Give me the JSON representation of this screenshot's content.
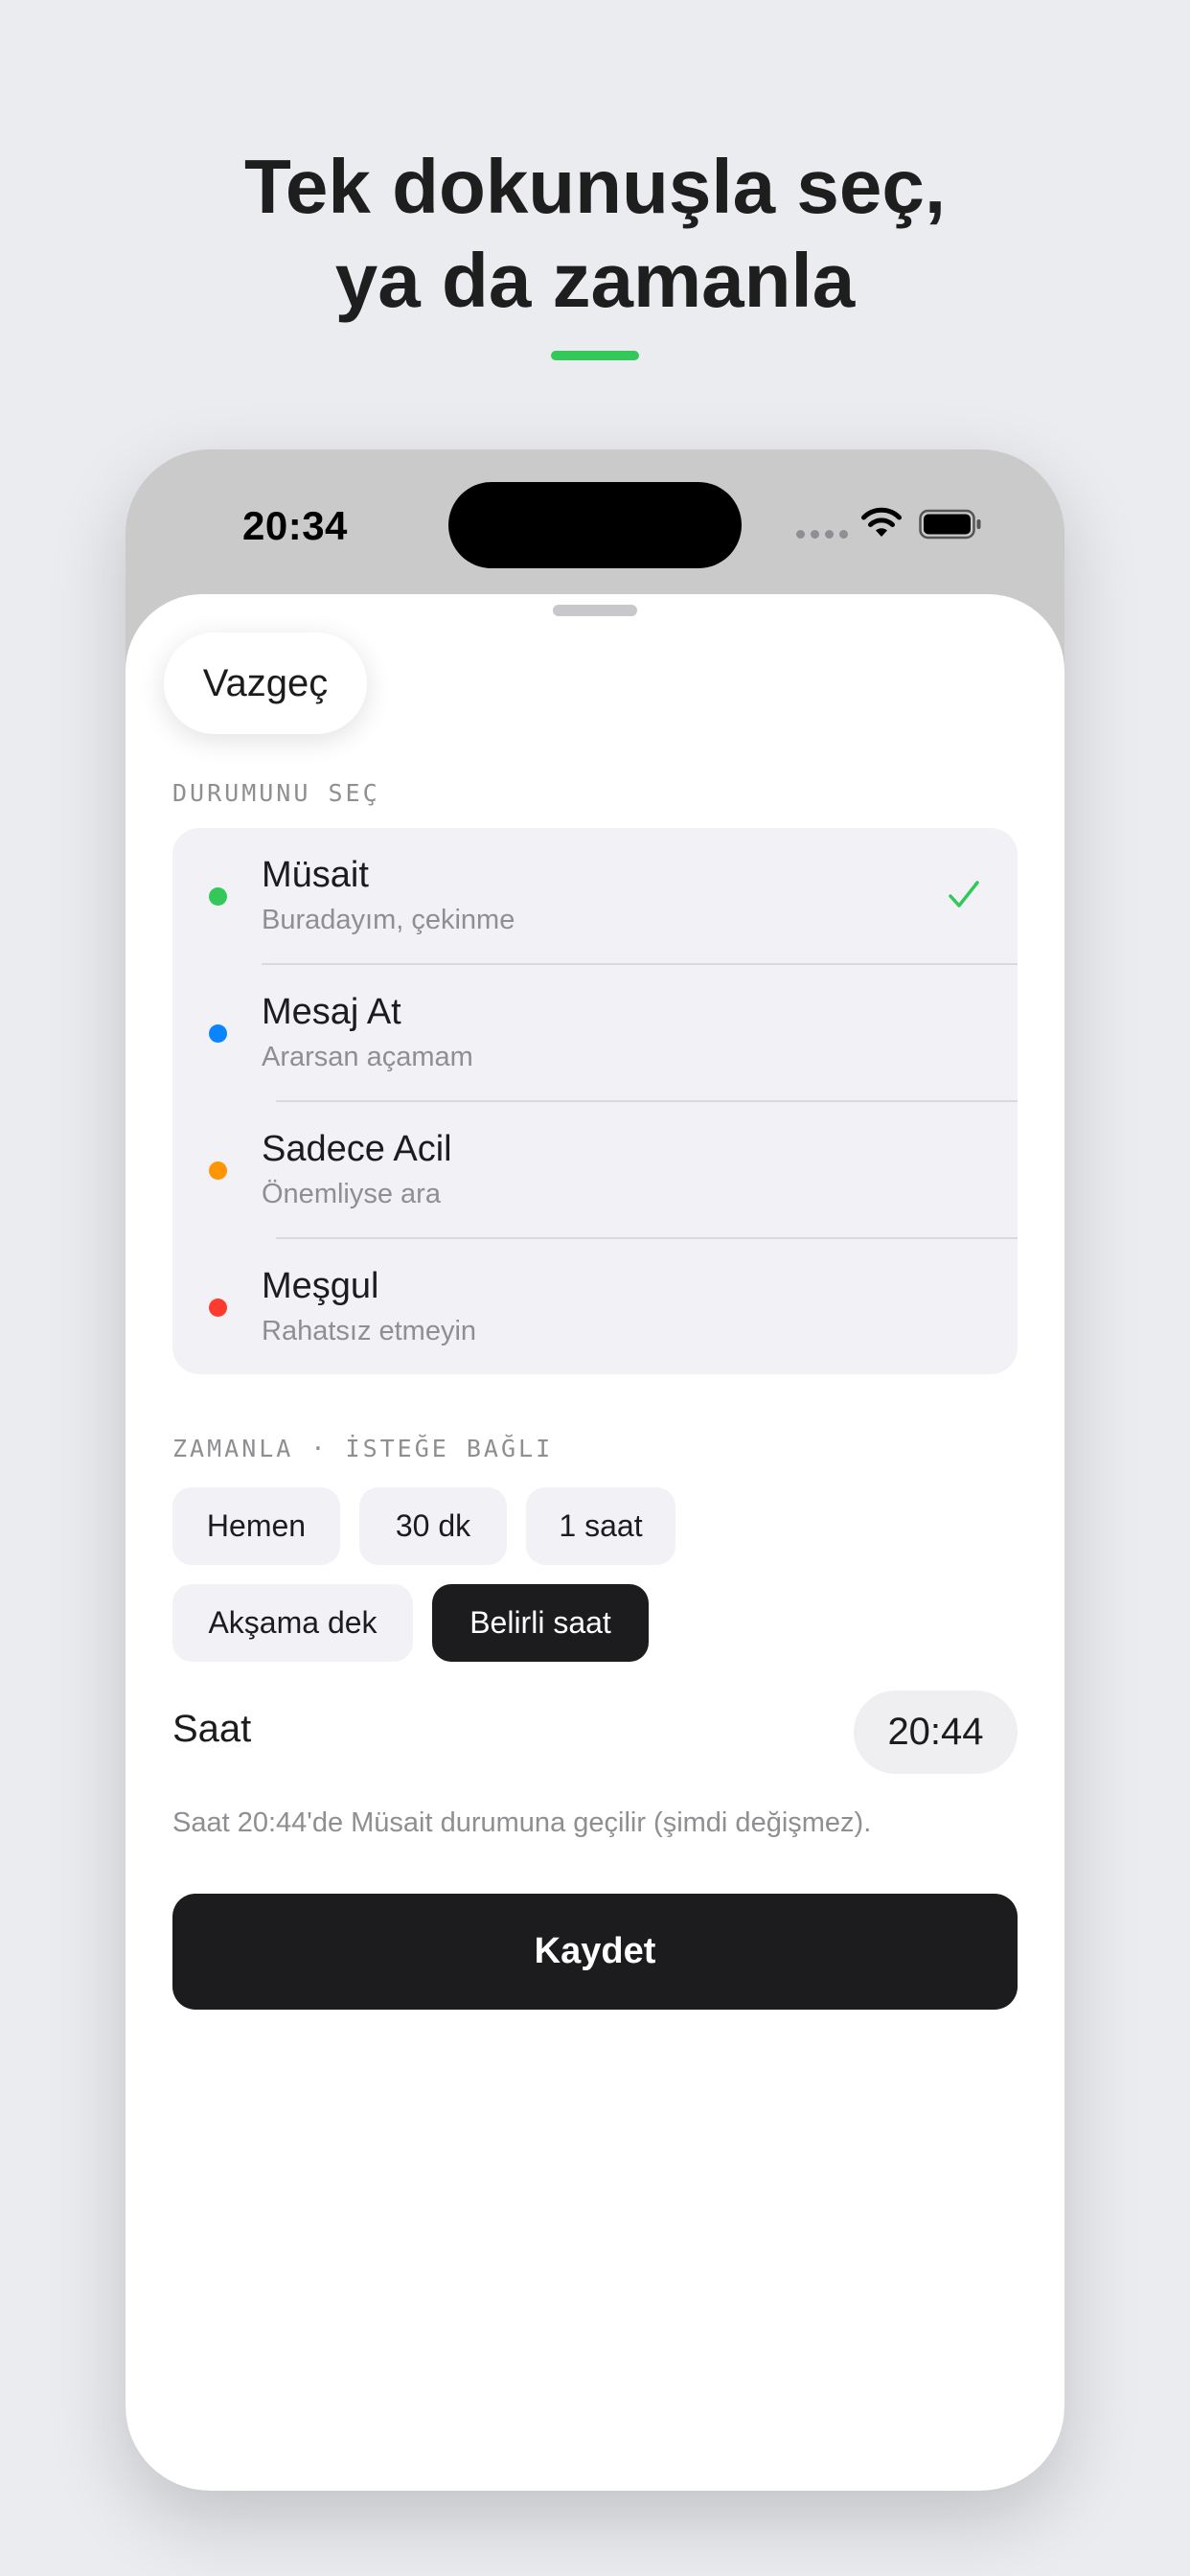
{
  "headline": {
    "line1": "Tek dokunuşla seç,",
    "line2": "ya da zamanla",
    "accent_color": "#34c759"
  },
  "status_bar": {
    "time": "20:34",
    "icons": [
      "cellular-signal-icon",
      "wifi-icon",
      "battery-icon"
    ]
  },
  "sheet": {
    "cancel_label": "Vazgeç",
    "status_section_label": "DURUMUNU SEÇ",
    "statuses": [
      {
        "title": "Müsait",
        "subtitle": "Buradayım, çekinme",
        "color": "#34c759",
        "selected": true
      },
      {
        "title": "Mesaj At",
        "subtitle": "Ararsan açamam",
        "color": "#0a84ff",
        "selected": false
      },
      {
        "title": "Sadece Acil",
        "subtitle": "Önemliyse ara",
        "color": "#ff9500",
        "selected": false
      },
      {
        "title": "Meşgul",
        "subtitle": "Rahatsız etmeyin",
        "color": "#ff3b30",
        "selected": false
      }
    ],
    "schedule_section_label": "ZAMANLA · İSTEĞE BAĞLI",
    "schedule_options": [
      {
        "label": "Hemen",
        "active": false
      },
      {
        "label": "30 dk",
        "active": false
      },
      {
        "label": "1 saat",
        "active": false
      },
      {
        "label": "Akşama dek",
        "active": false
      },
      {
        "label": "Belirli saat",
        "active": true
      }
    ],
    "time_label": "Saat",
    "time_value": "20:44",
    "note": "Saat 20:44'de Müsait durumuna geçilir (şimdi değişmez).",
    "save_label": "Kaydet"
  }
}
